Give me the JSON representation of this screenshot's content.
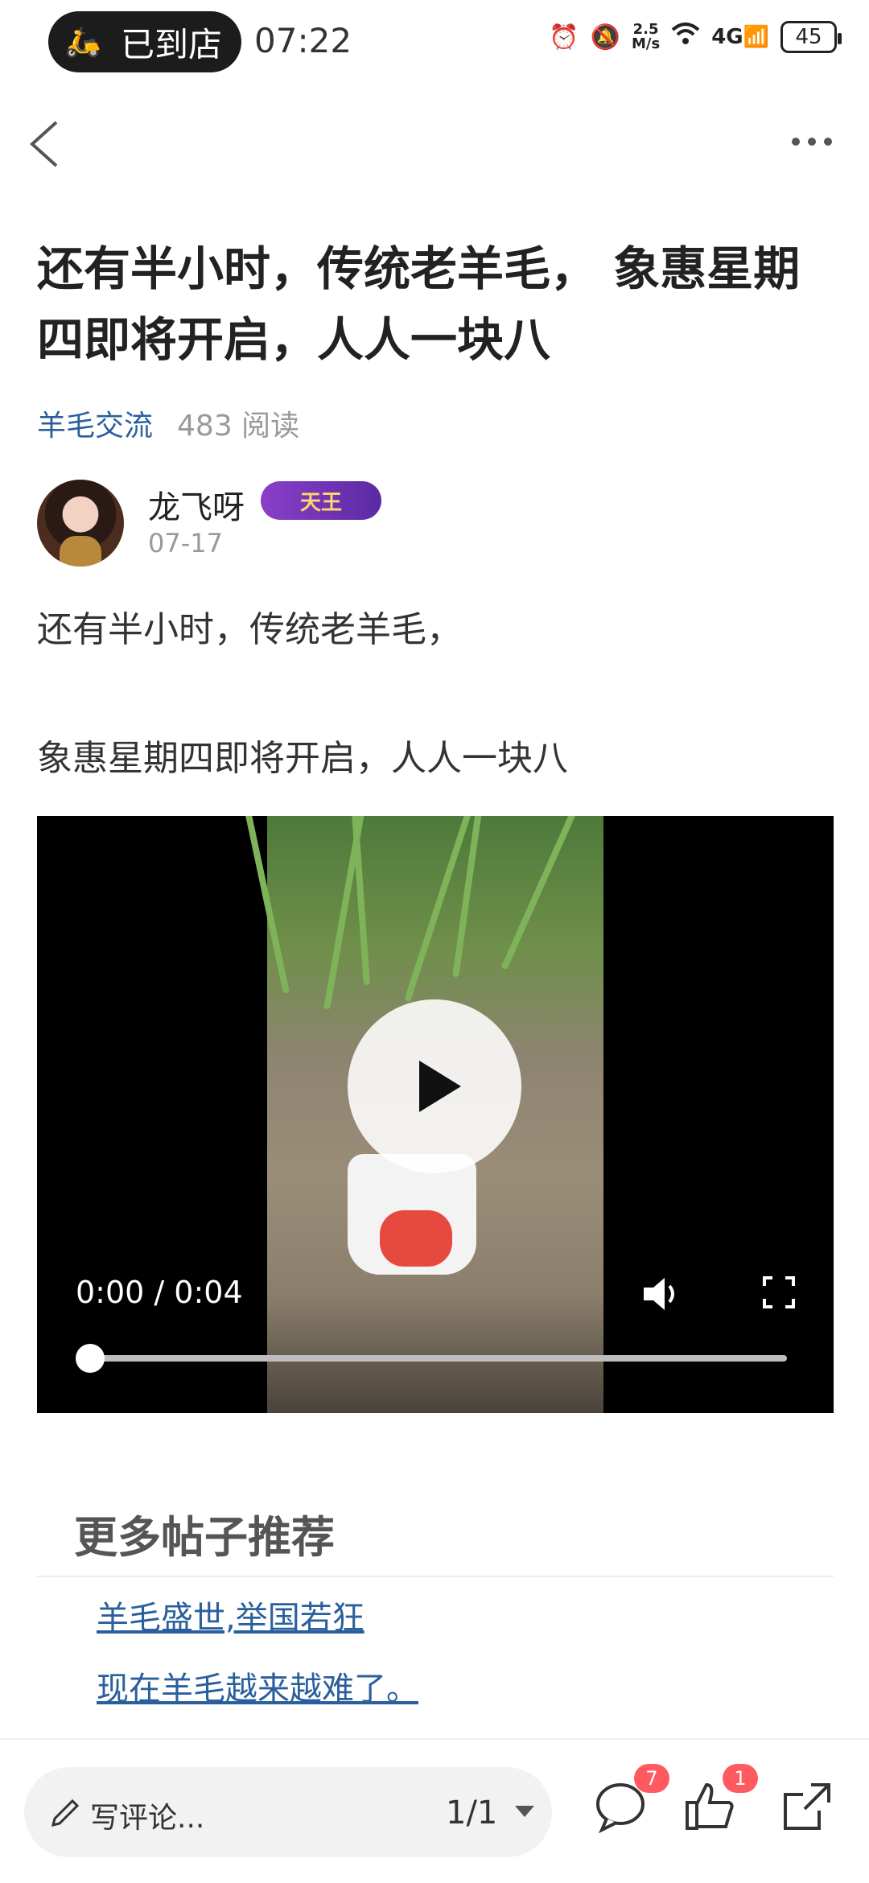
{
  "status_bar": {
    "pill_icon": "delivery-scooter-icon",
    "pill_text": "已到店",
    "time": "07:22",
    "net_speed_value": "2.5",
    "net_speed_unit": "M/s",
    "signal_label": "4G",
    "battery": "45"
  },
  "nav": {
    "back_icon": "chevron-left-icon",
    "more_icon": "more-dots-icon"
  },
  "post": {
    "title": "还有半小时，传统老羊毛， 象惠星期四即将开启，人人一块八",
    "forum": "羊毛交流",
    "reads": "483 阅读",
    "author": {
      "name": "龙飞呀",
      "badge": "天王",
      "date": "07-17"
    },
    "body_lines": [
      "还有半小时，传统老羊毛，",
      "象惠星期四即将开启，人人一块八"
    ]
  },
  "video": {
    "time_text": "0:00 / 0:04",
    "progress": 0.0,
    "play_icon": "play-icon",
    "volume_icon": "volume-icon",
    "fullscreen_icon": "fullscreen-icon"
  },
  "recommend": {
    "heading": "更多帖子推荐",
    "links": [
      "羊毛盛世,举国若狂",
      "现在羊毛越来越难了。"
    ]
  },
  "bottom_bar": {
    "comment_placeholder": "写评论...",
    "page_indicator": "1/1",
    "comment_count": "7",
    "like_count": "1"
  },
  "colors": {
    "link": "#2a5f9e",
    "badge_red": "#ff5a5f",
    "video_bg": "#000000"
  }
}
